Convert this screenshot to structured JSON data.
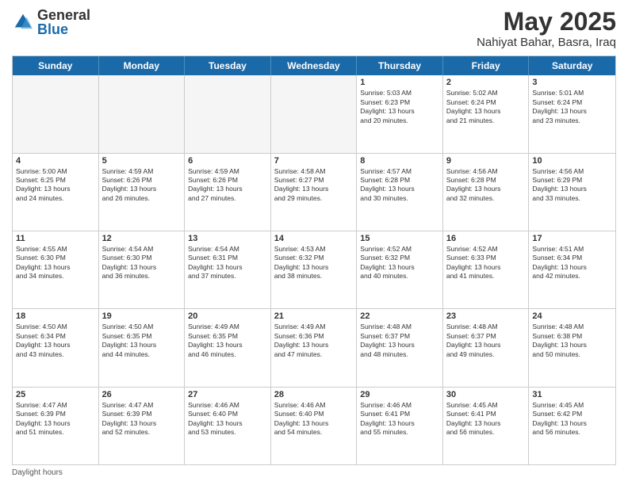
{
  "header": {
    "logo_general": "General",
    "logo_blue": "Blue",
    "month": "May 2025",
    "location": "Nahiyat Bahar, Basra, Iraq"
  },
  "days_of_week": [
    "Sunday",
    "Monday",
    "Tuesday",
    "Wednesday",
    "Thursday",
    "Friday",
    "Saturday"
  ],
  "rows": [
    [
      {
        "day": "",
        "detail": "",
        "empty": true
      },
      {
        "day": "",
        "detail": "",
        "empty": true
      },
      {
        "day": "",
        "detail": "",
        "empty": true
      },
      {
        "day": "",
        "detail": "",
        "empty": true
      },
      {
        "day": "1",
        "detail": "Sunrise: 5:03 AM\nSunset: 6:23 PM\nDaylight: 13 hours\nand 20 minutes.",
        "empty": false
      },
      {
        "day": "2",
        "detail": "Sunrise: 5:02 AM\nSunset: 6:24 PM\nDaylight: 13 hours\nand 21 minutes.",
        "empty": false
      },
      {
        "day": "3",
        "detail": "Sunrise: 5:01 AM\nSunset: 6:24 PM\nDaylight: 13 hours\nand 23 minutes.",
        "empty": false
      }
    ],
    [
      {
        "day": "4",
        "detail": "Sunrise: 5:00 AM\nSunset: 6:25 PM\nDaylight: 13 hours\nand 24 minutes.",
        "empty": false
      },
      {
        "day": "5",
        "detail": "Sunrise: 4:59 AM\nSunset: 6:26 PM\nDaylight: 13 hours\nand 26 minutes.",
        "empty": false
      },
      {
        "day": "6",
        "detail": "Sunrise: 4:59 AM\nSunset: 6:26 PM\nDaylight: 13 hours\nand 27 minutes.",
        "empty": false
      },
      {
        "day": "7",
        "detail": "Sunrise: 4:58 AM\nSunset: 6:27 PM\nDaylight: 13 hours\nand 29 minutes.",
        "empty": false
      },
      {
        "day": "8",
        "detail": "Sunrise: 4:57 AM\nSunset: 6:28 PM\nDaylight: 13 hours\nand 30 minutes.",
        "empty": false
      },
      {
        "day": "9",
        "detail": "Sunrise: 4:56 AM\nSunset: 6:28 PM\nDaylight: 13 hours\nand 32 minutes.",
        "empty": false
      },
      {
        "day": "10",
        "detail": "Sunrise: 4:56 AM\nSunset: 6:29 PM\nDaylight: 13 hours\nand 33 minutes.",
        "empty": false
      }
    ],
    [
      {
        "day": "11",
        "detail": "Sunrise: 4:55 AM\nSunset: 6:30 PM\nDaylight: 13 hours\nand 34 minutes.",
        "empty": false
      },
      {
        "day": "12",
        "detail": "Sunrise: 4:54 AM\nSunset: 6:30 PM\nDaylight: 13 hours\nand 36 minutes.",
        "empty": false
      },
      {
        "day": "13",
        "detail": "Sunrise: 4:54 AM\nSunset: 6:31 PM\nDaylight: 13 hours\nand 37 minutes.",
        "empty": false
      },
      {
        "day": "14",
        "detail": "Sunrise: 4:53 AM\nSunset: 6:32 PM\nDaylight: 13 hours\nand 38 minutes.",
        "empty": false
      },
      {
        "day": "15",
        "detail": "Sunrise: 4:52 AM\nSunset: 6:32 PM\nDaylight: 13 hours\nand 40 minutes.",
        "empty": false
      },
      {
        "day": "16",
        "detail": "Sunrise: 4:52 AM\nSunset: 6:33 PM\nDaylight: 13 hours\nand 41 minutes.",
        "empty": false
      },
      {
        "day": "17",
        "detail": "Sunrise: 4:51 AM\nSunset: 6:34 PM\nDaylight: 13 hours\nand 42 minutes.",
        "empty": false
      }
    ],
    [
      {
        "day": "18",
        "detail": "Sunrise: 4:50 AM\nSunset: 6:34 PM\nDaylight: 13 hours\nand 43 minutes.",
        "empty": false
      },
      {
        "day": "19",
        "detail": "Sunrise: 4:50 AM\nSunset: 6:35 PM\nDaylight: 13 hours\nand 44 minutes.",
        "empty": false
      },
      {
        "day": "20",
        "detail": "Sunrise: 4:49 AM\nSunset: 6:35 PM\nDaylight: 13 hours\nand 46 minutes.",
        "empty": false
      },
      {
        "day": "21",
        "detail": "Sunrise: 4:49 AM\nSunset: 6:36 PM\nDaylight: 13 hours\nand 47 minutes.",
        "empty": false
      },
      {
        "day": "22",
        "detail": "Sunrise: 4:48 AM\nSunset: 6:37 PM\nDaylight: 13 hours\nand 48 minutes.",
        "empty": false
      },
      {
        "day": "23",
        "detail": "Sunrise: 4:48 AM\nSunset: 6:37 PM\nDaylight: 13 hours\nand 49 minutes.",
        "empty": false
      },
      {
        "day": "24",
        "detail": "Sunrise: 4:48 AM\nSunset: 6:38 PM\nDaylight: 13 hours\nand 50 minutes.",
        "empty": false
      }
    ],
    [
      {
        "day": "25",
        "detail": "Sunrise: 4:47 AM\nSunset: 6:39 PM\nDaylight: 13 hours\nand 51 minutes.",
        "empty": false
      },
      {
        "day": "26",
        "detail": "Sunrise: 4:47 AM\nSunset: 6:39 PM\nDaylight: 13 hours\nand 52 minutes.",
        "empty": false
      },
      {
        "day": "27",
        "detail": "Sunrise: 4:46 AM\nSunset: 6:40 PM\nDaylight: 13 hours\nand 53 minutes.",
        "empty": false
      },
      {
        "day": "28",
        "detail": "Sunrise: 4:46 AM\nSunset: 6:40 PM\nDaylight: 13 hours\nand 54 minutes.",
        "empty": false
      },
      {
        "day": "29",
        "detail": "Sunrise: 4:46 AM\nSunset: 6:41 PM\nDaylight: 13 hours\nand 55 minutes.",
        "empty": false
      },
      {
        "day": "30",
        "detail": "Sunrise: 4:45 AM\nSunset: 6:41 PM\nDaylight: 13 hours\nand 56 minutes.",
        "empty": false
      },
      {
        "day": "31",
        "detail": "Sunrise: 4:45 AM\nSunset: 6:42 PM\nDaylight: 13 hours\nand 56 minutes.",
        "empty": false
      }
    ]
  ],
  "footer": {
    "note": "Daylight hours"
  }
}
